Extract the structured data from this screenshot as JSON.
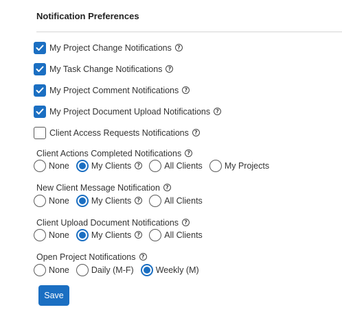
{
  "header": {
    "title": "Notification Preferences"
  },
  "checkboxes": [
    {
      "label": "My Project Change Notifications",
      "checked": true
    },
    {
      "label": "My Task Change Notifications",
      "checked": true
    },
    {
      "label": "My Project Comment Notifications",
      "checked": true
    },
    {
      "label": "My Project Document Upload Notifications",
      "checked": true
    },
    {
      "label": "Client Access Requests Notifications",
      "checked": false
    }
  ],
  "groups": [
    {
      "label": "Client Actions Completed Notifications",
      "options": [
        "None",
        "My Clients",
        "All Clients",
        "My Projects"
      ],
      "selected": "My Clients"
    },
    {
      "label": "New Client Message Notification",
      "options": [
        "None",
        "My Clients",
        "All Clients"
      ],
      "selected": "My Clients"
    },
    {
      "label": "Client Upload Document Notifications",
      "options": [
        "None",
        "My Clients",
        "All Clients"
      ],
      "selected": "My Clients"
    },
    {
      "label": "Open Project Notifications",
      "options": [
        "None",
        "Daily (M-F)",
        "Weekly (M)"
      ],
      "selected": "Weekly (M)"
    }
  ],
  "help_icon_glyph": "?",
  "save_label": "Save",
  "colors": {
    "accent": "#1b6fc2"
  }
}
